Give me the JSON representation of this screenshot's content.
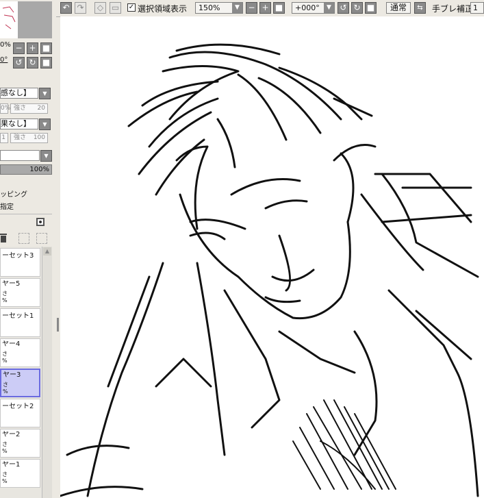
{
  "toolbar": {
    "selection_label": "選択領域表示",
    "zoom_value": "150%",
    "rotation_value": "+000°",
    "blend_mode": "通常",
    "stabilizer_label": "手ブレ補正",
    "stabilizer_value": "1"
  },
  "left_panel": {
    "nav_zoom_fragment": "0%",
    "nav_rot_fragment": "0°",
    "texture_value": "感なし】",
    "texture_percent": "0%",
    "texture_strength_label": "強さ",
    "texture_strength_value": "20",
    "effect_value": "果なし】",
    "effect_percent": "1",
    "effect_strength_label": "強さ",
    "effect_strength_value": "100",
    "opacity_value": "100%",
    "clipping_label": "ッピング",
    "selection_source_label": "指定"
  },
  "layers": [
    {
      "name": "ーセット3",
      "type": "folder",
      "selected": false
    },
    {
      "name": "ヤー5",
      "type": "layer",
      "selected": false,
      "line2": "さ",
      "line3": "%"
    },
    {
      "name": "ーセット1",
      "type": "folder",
      "selected": false
    },
    {
      "name": "ヤー4",
      "type": "layer",
      "selected": false,
      "line2": "さ",
      "line3": "%"
    },
    {
      "name": "ヤー3",
      "type": "layer",
      "selected": true,
      "line2": "さ",
      "line3": "%"
    },
    {
      "name": "ーセット2",
      "type": "folder",
      "selected": false
    },
    {
      "name": "ヤー2",
      "type": "layer",
      "selected": false,
      "line2": "さ",
      "line3": "%"
    },
    {
      "name": "ヤー1",
      "type": "layer",
      "selected": false,
      "line2": "さ",
      "line3": "%"
    }
  ],
  "colors": {
    "selected_layer": "#ccccf6",
    "panel_bg": "#ece9e2"
  }
}
